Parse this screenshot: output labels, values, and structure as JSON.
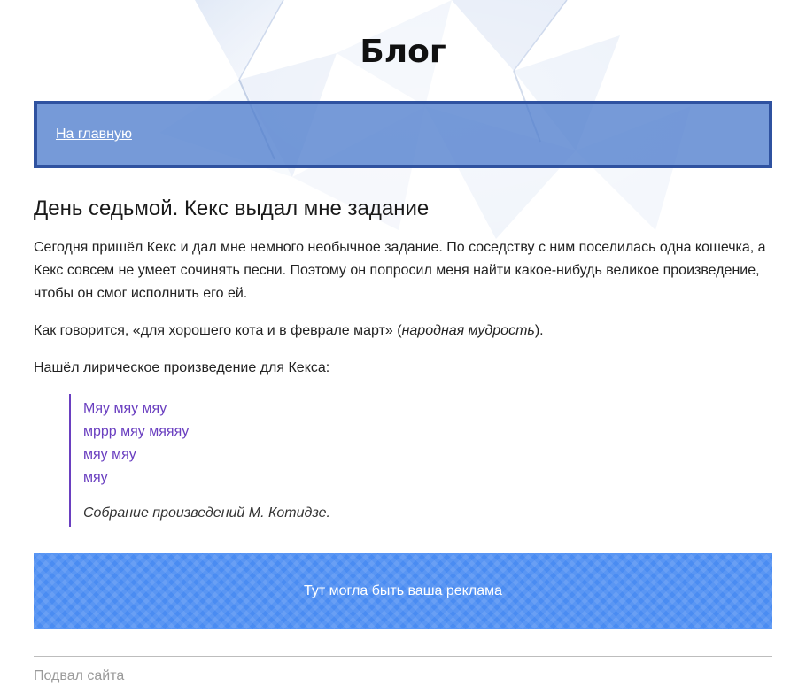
{
  "header": {
    "title": "Блог"
  },
  "nav": {
    "home_link": "На главную"
  },
  "post": {
    "title": "День седьмой. Кекс выдал мне задание",
    "paragraphs": [
      "Сегодня пришёл Кекс и дал мне немного необычное задание. По соседству с ним поселилась одна кошечка, а Кекс совсем не умеет сочинять песни. Поэтому он попросил меня найти какое-нибудь великое произведение, чтобы он смог исполнить его ей."
    ],
    "quote_para": {
      "before": "Как говорится, «для хорошего кота и в феврале март» (",
      "emphasis": "народная мудрость",
      "after": ")."
    },
    "intro_poem": "Нашёл лирическое произведение для Кекса:",
    "poem": {
      "lines": [
        "Мяу мяу мяу",
        "мррр мяу мяяяу",
        "мяу мяу",
        "мяу"
      ],
      "cite": "Собрание произведений М. Котидзе."
    }
  },
  "ad": {
    "text": "Тут могла быть ваша реклама"
  },
  "footer": {
    "text": "Подвал сайта"
  },
  "colors": {
    "nav_border": "#2f52a0",
    "nav_bg": "#5a7dcd",
    "poem_accent": "#6a3fc0",
    "ad_bg": "#4a8cf2"
  }
}
